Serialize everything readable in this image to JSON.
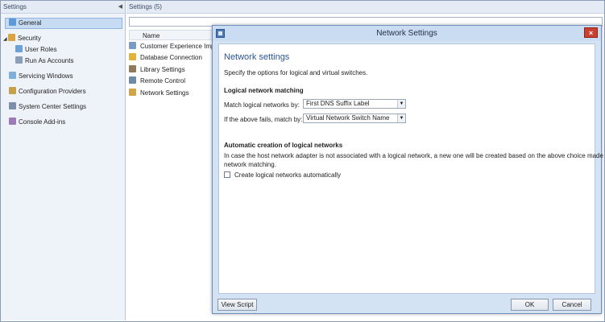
{
  "nav": {
    "title": "Settings",
    "items": [
      {
        "label": "General"
      },
      {
        "label": "Security"
      },
      {
        "label": "User Roles"
      },
      {
        "label": "Run As Accounts"
      },
      {
        "label": "Servicing Windows"
      },
      {
        "label": "Configuration Providers"
      },
      {
        "label": "System Center Settings"
      },
      {
        "label": "Console Add-ins"
      }
    ]
  },
  "list": {
    "title": "Settings (5)",
    "column_header": "Name",
    "rows": [
      {
        "label": "Customer Experience Imp"
      },
      {
        "label": "Database Connection"
      },
      {
        "label": "Library Settings"
      },
      {
        "label": "Remote Control"
      },
      {
        "label": "Network Settings"
      }
    ]
  },
  "dialog": {
    "title": "Network Settings",
    "close_label": "×",
    "heading": "Network settings",
    "description": "Specify the options for logical and virtual switches.",
    "section1_title": "Logical network matching",
    "match_label": "Match logical networks by:",
    "match_value": "First DNS Suffix Label",
    "fallback_label": "If the above fails, match by:",
    "fallback_value": "Virtual Network Switch Name",
    "section2_title": "Automatic creation of logical networks",
    "section2_text_line1": "In case the host network adapter is not associated with a logical network, a new one will be created based on the above choice made for",
    "section2_text_line2": "network matching.",
    "checkbox_label": "Create logical networks automatically",
    "view_script_label": "View Script",
    "ok_label": "OK",
    "cancel_label": "Cancel"
  },
  "colors": {
    "dialog_heading": "#2a5594",
    "selection": "#c7dcf3",
    "close_button": "#c8402f"
  }
}
